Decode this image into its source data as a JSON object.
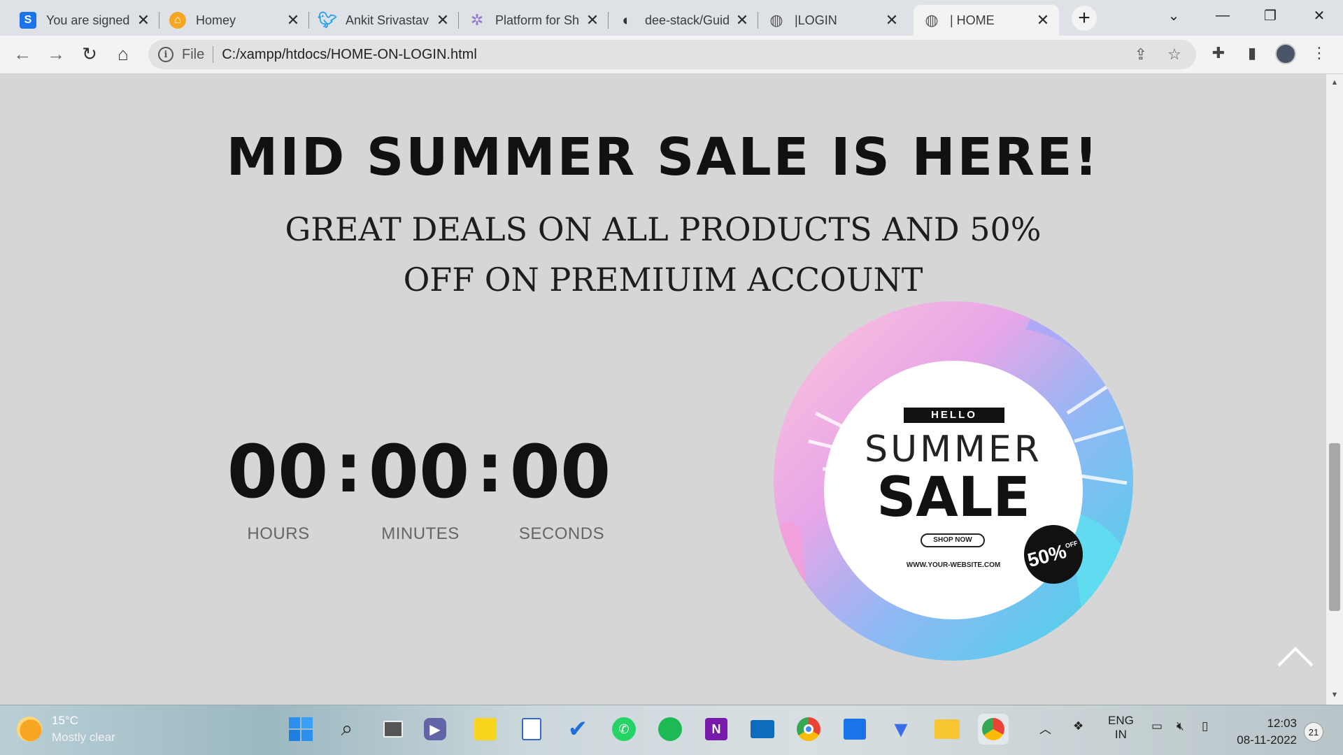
{
  "browser": {
    "tabs": [
      {
        "title": "You are signed",
        "favicon": "S",
        "color": "#1a73e8"
      },
      {
        "title": "Homey",
        "favicon": "⌂",
        "color": "#f5a623"
      },
      {
        "title": "Ankit Srivastav",
        "favicon": "t",
        "color": "#1da1f2"
      },
      {
        "title": "Platform for Sh",
        "favicon": "✲",
        "color": "#b39ddb"
      },
      {
        "title": "dee-stack/Guid",
        "favicon": "◐",
        "color": "#333333"
      },
      {
        "title": "|LOGIN",
        "favicon": "◍",
        "color": "#555555"
      },
      {
        "title": "| HOME",
        "favicon": "◍",
        "color": "#555555"
      }
    ],
    "new_tab": "+",
    "address": {
      "scheme": "File",
      "url": "C:/xampp/htdocs/HOME-ON-LOGIN.html"
    }
  },
  "page": {
    "headline": "MID SUMMER SALE IS HERE!",
    "subline": "GREAT DEALS ON ALL PRODUCTS AND 50% OFF ON PREMIUIM ACCOUNT",
    "timer": {
      "hours": "00",
      "minutes": "00",
      "seconds": "00",
      "separator": ":",
      "hours_label": "HOURS",
      "minutes_label": "MINUTES",
      "seconds_label": "SECONDS"
    },
    "sale_image": {
      "hello": "HELLO",
      "summer": "SUMMER",
      "sale": "SALE",
      "shop_now": "SHOP NOW",
      "website": "WWW.YOUR-WEBSITE.COM",
      "discount": "50%",
      "discount_suffix": "OFF"
    }
  },
  "taskbar": {
    "weather_temp": "15°C",
    "weather_desc": "Mostly clear",
    "lang_top": "ENG",
    "lang_bottom": "IN",
    "time": "12:03",
    "date": "08-11-2022",
    "notifications": "21"
  }
}
